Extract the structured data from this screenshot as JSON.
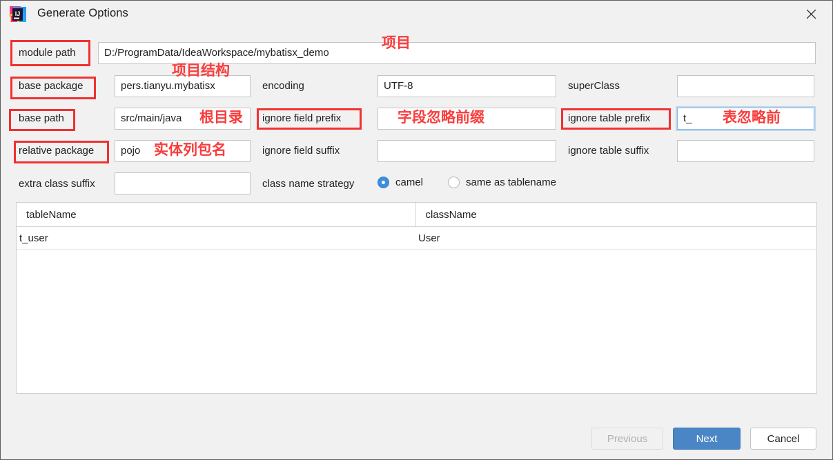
{
  "window": {
    "title": "Generate Options",
    "app_icon": "intellij-idea-icon",
    "close_icon": "close-icon"
  },
  "form": {
    "module_path": {
      "label": "module path",
      "value": "D:/ProgramData/IdeaWorkspace/mybatisx_demo",
      "focused": false
    },
    "base_package": {
      "label": "base package",
      "value": "pers.tianyu.mybatisx",
      "focused": false
    },
    "base_path": {
      "label": "base path",
      "value": "src/main/java",
      "focused": false
    },
    "relative_package": {
      "label": "relative package",
      "value": "pojo",
      "focused": false
    },
    "extra_class_suffix": {
      "label": "extra class suffix",
      "value": "",
      "focused": false
    },
    "encoding": {
      "label": "encoding",
      "value": "UTF-8",
      "focused": false
    },
    "ignore_field_prefix": {
      "label": "ignore field prefix",
      "value": "",
      "focused": false
    },
    "ignore_field_suffix": {
      "label": "ignore field suffix",
      "value": "",
      "focused": false
    },
    "super_class": {
      "label": "superClass",
      "value": "",
      "focused": false
    },
    "ignore_table_prefix": {
      "label": "ignore table prefix",
      "value": "t_",
      "focused": true
    },
    "ignore_table_suffix": {
      "label": "ignore table suffix",
      "value": "",
      "focused": false
    },
    "class_name_strategy": {
      "label": "class name strategy",
      "options": [
        {
          "label": "camel",
          "selected": true
        },
        {
          "label": "same as tablename",
          "selected": false
        }
      ]
    }
  },
  "table": {
    "columns": [
      "tableName",
      "className"
    ],
    "rows": [
      {
        "tableName": "t_user",
        "className": "User"
      }
    ]
  },
  "buttons": {
    "previous": {
      "label": "Previous",
      "state": "disabled"
    },
    "next": {
      "label": "Next",
      "state": "default"
    },
    "cancel": {
      "label": "Cancel",
      "state": "normal"
    }
  },
  "annotations": {
    "project": "项目",
    "project_structure": "项目结构",
    "root_dir": "根目录",
    "entity_package": "实体列包名",
    "field_ignore_prefix": "字段忽略前缀",
    "table_ignore_prefix": "表忽略前"
  },
  "colors": {
    "accent": "#4a86c5",
    "radio_selected": "#3e8fdb",
    "annotation": "#fa3c3c",
    "dialog_bg": "#f1f1f1",
    "focus_ring": "#bdd8f0"
  }
}
